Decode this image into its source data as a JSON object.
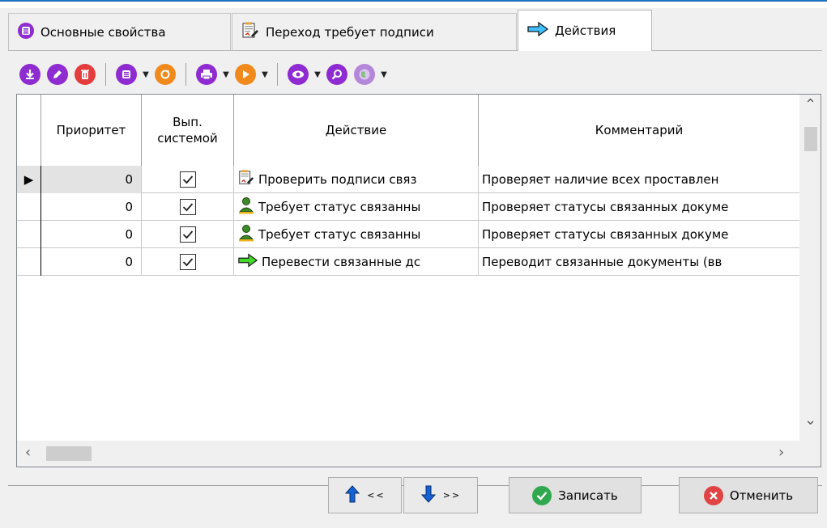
{
  "tabs": [
    {
      "label": "Основные свойства",
      "icon": "list-icon"
    },
    {
      "label": "Переход требует подписи",
      "icon": "document-sign-icon"
    },
    {
      "label": "Действия",
      "icon": "arrow-right-icon"
    }
  ],
  "active_tab_index": 2,
  "toolbar": {
    "items": [
      "add-icon",
      "edit-icon",
      "delete-icon",
      "list-icon",
      "refresh-icon",
      "print-icon",
      "play-icon",
      "view-icon",
      "search-icon",
      "globe-icon"
    ]
  },
  "grid": {
    "columns": [
      "Приоритет",
      "Вып. системой",
      "Действие",
      "Комментарий"
    ],
    "column_header_2_line1": "Вып.",
    "column_header_2_line2": "системой",
    "rows": [
      {
        "priority": "0",
        "system": true,
        "action": "Проверить подписи связ",
        "action_icon": "document-sign-icon",
        "comment": "Проверяет наличие всех проставлен"
      },
      {
        "priority": "0",
        "system": true,
        "action": "Требует статус связанны",
        "action_icon": "user-icon",
        "comment": "Проверяет статусы связанных докуме"
      },
      {
        "priority": "0",
        "system": true,
        "action": "Требует статус связанны",
        "action_icon": "user-icon",
        "comment": "Проверяет статусы связанных докуме"
      },
      {
        "priority": "0",
        "system": true,
        "action": "Перевести связанные дс",
        "action_icon": "arrow-right-icon",
        "comment": "Переводит связанные документы (вв"
      }
    ],
    "selected_row": 0
  },
  "footer": {
    "prev_label": "<<",
    "next_label": ">>",
    "save_label": "Записать",
    "cancel_label": "Отменить"
  },
  "colors": {
    "accent": "#8e2bd1",
    "save": "#2fa84f",
    "cancel": "#e04343",
    "nav_arrow": "#1463d6"
  }
}
